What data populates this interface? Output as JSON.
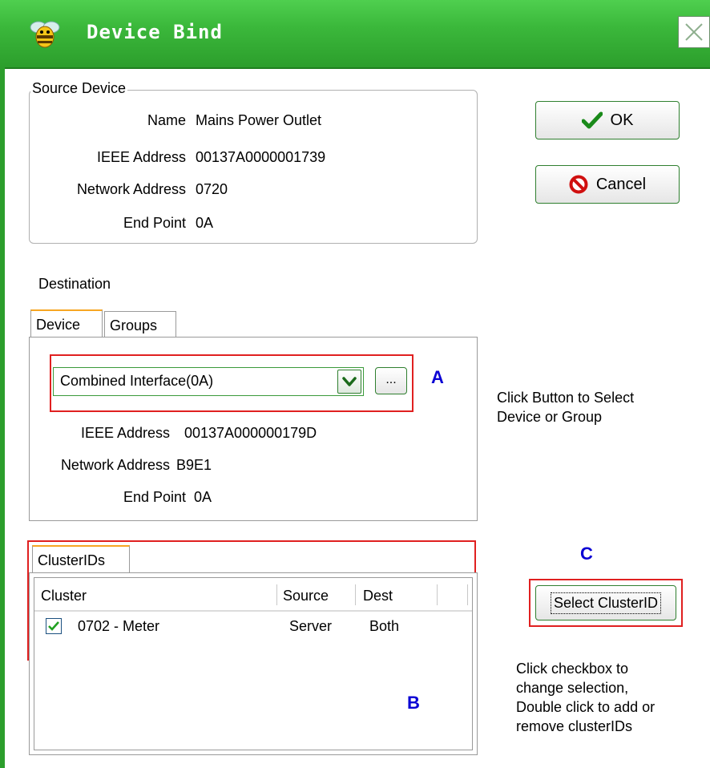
{
  "window": {
    "title": "Device Bind",
    "close_glyph": "✕"
  },
  "source": {
    "legend": "Source Device",
    "name_label": "Name",
    "name_value": "Mains Power Outlet",
    "ieee_label": "IEEE Address",
    "ieee_value": "00137A0000001739",
    "nwk_label": "Network Address",
    "nwk_value": "0720",
    "ep_label": "End Point",
    "ep_value": "0A"
  },
  "buttons": {
    "ok": "OK",
    "cancel": "Cancel",
    "browse": "...",
    "select_cluster": "Select ClusterID"
  },
  "destination": {
    "label": "Destination",
    "tabs": [
      "Device",
      "Groups"
    ],
    "combo_value": "Combined Interface(0A)",
    "ieee_label": "IEEE Address",
    "ieee_value": "00137A000000179D",
    "nwk_label": "Network Address",
    "nwk_value": "B9E1",
    "ep_label": "End Point",
    "ep_value": "0A"
  },
  "clusters": {
    "tab": "ClusterIDs",
    "columns": [
      "Cluster",
      "Source",
      "Dest"
    ],
    "rows": [
      {
        "checked": true,
        "cluster": "0702 - Meter",
        "source": "Server",
        "dest": "Both"
      }
    ]
  },
  "annotations": {
    "a": "A",
    "b": "B",
    "c": "C",
    "note_select_1": "Click Button to Select",
    "note_select_2": "Device or Group",
    "note_check_1": "Click checkbox to",
    "note_check_2": "change selection,",
    "note_check_3": "Double click to add or",
    "note_check_4": "remove clusterIDs"
  },
  "colors": {
    "titlebar": "#3bb83b",
    "annotation_box": "#e02020",
    "annotation_letter": "#0a00d4"
  }
}
